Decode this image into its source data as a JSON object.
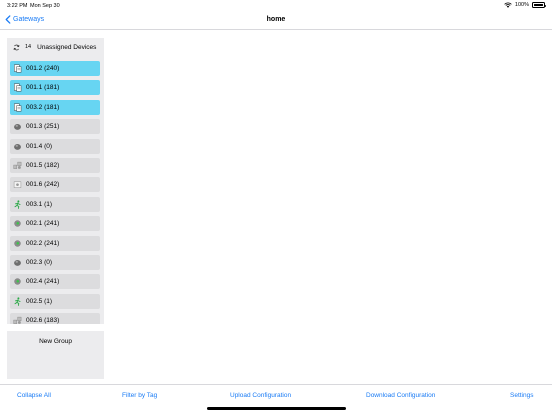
{
  "status_bar": {
    "time": "3:22 PM",
    "date": "Mon Sep 30",
    "battery": "100%"
  },
  "nav": {
    "back_label": "Gateways",
    "title": "home"
  },
  "unassigned": {
    "count": "14",
    "label": "Unassigned Devices"
  },
  "devices": [
    {
      "label": "001.2 (240)",
      "icon": "document-device-icon",
      "selected": true
    },
    {
      "label": "001.1 (181)",
      "icon": "document-device-icon",
      "selected": true
    },
    {
      "label": "003.2 (181)",
      "icon": "document-device-icon",
      "selected": true
    },
    {
      "label": "001.3 (251)",
      "icon": "sensor-dome-icon",
      "selected": false
    },
    {
      "label": "001.4 (0)",
      "icon": "sensor-dome-icon",
      "selected": false
    },
    {
      "label": "001.5 (182)",
      "icon": "multi-sensor-icon",
      "selected": false
    },
    {
      "label": "001.6 (242)",
      "icon": "sensor-box-icon",
      "selected": false
    },
    {
      "label": "003.1 (1)",
      "icon": "running-person-icon",
      "selected": false
    },
    {
      "label": "002.1 (241)",
      "icon": "green-dot-sensor-icon",
      "selected": false
    },
    {
      "label": "002.2 (241)",
      "icon": "green-dot-sensor-icon",
      "selected": false
    },
    {
      "label": "002.3 (0)",
      "icon": "sensor-dome-icon",
      "selected": false
    },
    {
      "label": "002.4 (241)",
      "icon": "green-dot-sensor-icon",
      "selected": false
    },
    {
      "label": "002.5 (1)",
      "icon": "running-person-icon",
      "selected": false
    },
    {
      "label": "002.6 (183)",
      "icon": "multi-sensor-icon",
      "selected": false
    }
  ],
  "new_group": {
    "label": "New Group"
  },
  "bottom_bar": {
    "collapse_all": "Collapse All",
    "filter_by_tag": "Filter by Tag",
    "upload_configuration": "Upload Configuration",
    "download_configuration": "Download Configuration",
    "settings": "Settings"
  },
  "colors": {
    "accent": "#1b7cf5",
    "selected": "#67d5f2",
    "item_bg": "#dcdcde",
    "panel_bg": "#ececee",
    "person_green": "#27a844"
  }
}
